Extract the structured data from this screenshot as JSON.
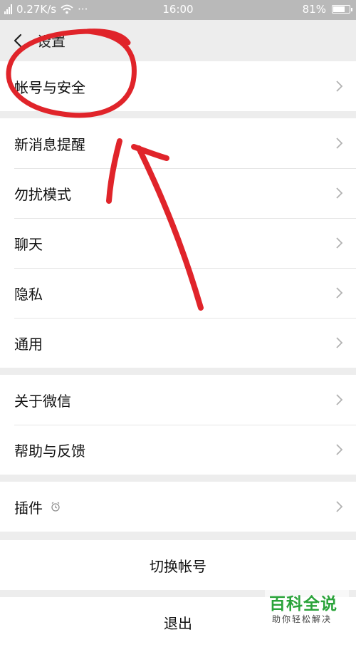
{
  "status_bar": {
    "speed": "0.27K/s",
    "dots": "···",
    "time": "16:00",
    "battery_percent": "81%",
    "battery_level": 0.81
  },
  "nav": {
    "title": "设置"
  },
  "groups": {
    "account": {
      "label": "帐号与安全"
    },
    "notifications": {
      "label": "新消息提醒"
    },
    "dnd": {
      "label": "勿扰模式"
    },
    "chat": {
      "label": "聊天"
    },
    "privacy": {
      "label": "隐私"
    },
    "general": {
      "label": "通用"
    },
    "about": {
      "label": "关于微信"
    },
    "help": {
      "label": "帮助与反馈"
    },
    "plugins": {
      "label": "插件",
      "icon": "alarm-clock-icon"
    },
    "switch_account": {
      "label": "切换帐号"
    },
    "logout": {
      "label": "退出"
    }
  },
  "watermark": {
    "main": "百科全说",
    "sub": "助你轻松解决"
  },
  "colors": {
    "annotation": "#e0242a",
    "watermark_green": "#2aa33a",
    "background": "#ededed"
  }
}
